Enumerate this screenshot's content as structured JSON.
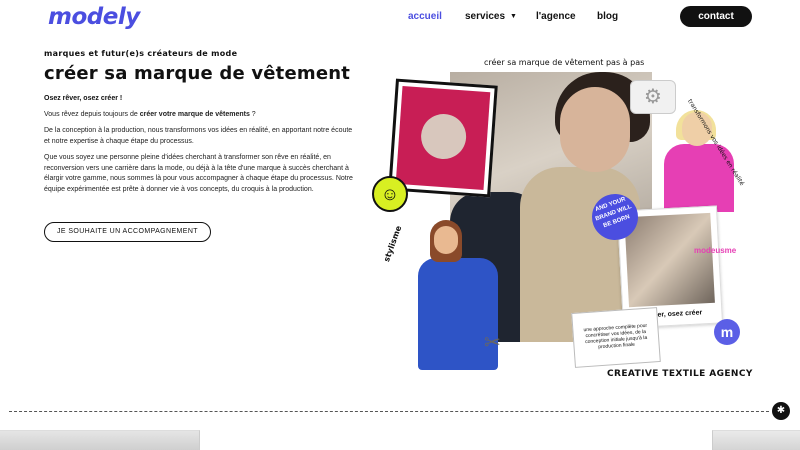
{
  "header": {
    "logo": "modely",
    "nav": [
      {
        "label": "accueil",
        "active": true
      },
      {
        "label": "services",
        "has_dropdown": true
      },
      {
        "label": "l'agence"
      },
      {
        "label": "blog"
      }
    ],
    "contact": "contact"
  },
  "hero": {
    "eyebrow": "marques et futur(e)s créateurs de mode",
    "title": "créer sa marque de vêtement",
    "subtitle": "Osez rêver, osez créer !",
    "p1_before": "Vous rêvez depuis toujours de ",
    "p1_bold": "créer votre marque de vêtements",
    "p1_after": " ?",
    "p2": "De la conception à la production, nous transformons vos idées en réalité, en apportant notre écoute et notre expertise à chaque étape du processus.",
    "p3": "Que vous soyez une personne pleine d'idées cherchant à transformer son rêve en réalité, en reconversion vers une carrière dans la mode, ou déjà à la tête d'une marque à succès cherchant à élargir votre gamme, nous sommes là pour vous accompagner à chaque étape du processus. Notre équipe expérimentée est prête à donner vie à vos concepts, du croquis à la production.",
    "cta": "je souhaite un accompagnement"
  },
  "collage": {
    "title": "créer sa marque de vêtement pas à pas",
    "side_text": "transformons vos idées en réalité",
    "badge": "and your brand will be born",
    "modeusme": "modeusme",
    "polaroid_caption": "osez rêver, osez créer",
    "note": "une approche complète pour concrétiser vos idées, de la conception initiale jusqu'à la production finale",
    "creative": "creative textile agency",
    "stylisme": "stylisme",
    "m_badge": "m"
  },
  "icons": {
    "smiley": "smiley-icon",
    "scissors": "scissors-icon",
    "sewing": "sewing-machine-icon",
    "scroll": "arrow-icon"
  },
  "colors": {
    "accent": "#4b4ee0",
    "pink": "#e63fb4",
    "crimson": "#c81e55",
    "lime": "#d8ef22"
  }
}
